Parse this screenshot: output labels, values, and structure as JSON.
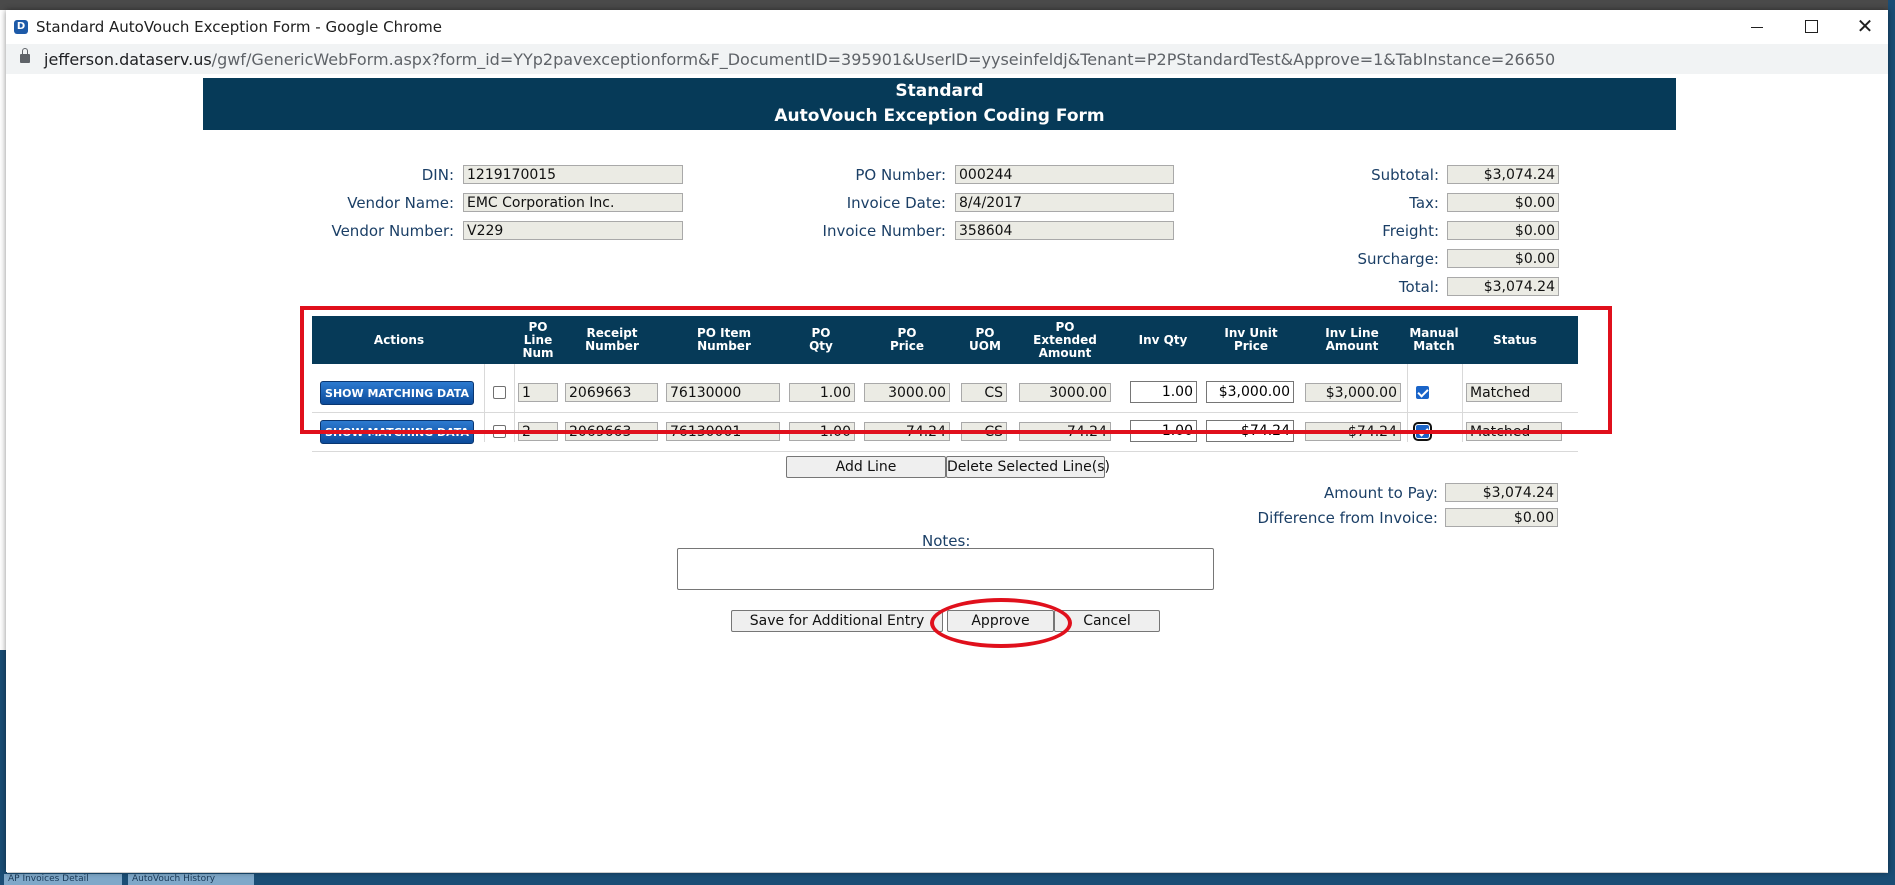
{
  "window": {
    "title": "Standard AutoVouch Exception Form - Google Chrome",
    "url_host": "jefferson.dataserv.us",
    "url_path": "/gwf/GenericWebForm.aspx?form_id=YYp2pavexceptionform&F_DocumentID=395901&UserID=yyseinfeldj&Tenant=P2PStandardTest&Approve=1&TabInstance=26650",
    "close_glyph": "✕"
  },
  "background_tabs": [
    "AP Invoices Detail",
    "AutoVouch History"
  ],
  "header": {
    "line1": "Standard",
    "line2": "AutoVouch Exception Coding Form"
  },
  "info": {
    "din_label": "DIN:",
    "din": "1219170015",
    "vendor_name_label": "Vendor Name:",
    "vendor_name": "EMC Corporation Inc.",
    "vendor_number_label": "Vendor Number:",
    "vendor_number": "V229",
    "po_number_label": "PO Number:",
    "po_number": "000244",
    "invoice_date_label": "Invoice Date:",
    "invoice_date": "8/4/2017",
    "invoice_number_label": "Invoice Number:",
    "invoice_number": "358604"
  },
  "totals": {
    "subtotal_label": "Subtotal:",
    "subtotal": "$3,074.24",
    "tax_label": "Tax:",
    "tax": "$0.00",
    "freight_label": "Freight:",
    "freight": "$0.00",
    "surcharge_label": "Surcharge:",
    "surcharge": "$0.00",
    "total_label": "Total:",
    "total": "$3,074.24"
  },
  "grid": {
    "headers": {
      "actions": "Actions",
      "po_line_num": "PO\nLine\nNum",
      "receipt_number": "Receipt\nNumber",
      "po_item_number": "PO Item\nNumber",
      "po_qty": "PO\nQty",
      "po_price": "PO\nPrice",
      "po_uom": "PO\nUOM",
      "po_extended_amount": "PO\nExtended\nAmount",
      "inv_qty": "Inv Qty",
      "inv_unit_price": "Inv Unit\nPrice",
      "inv_line_amount": "Inv Line\nAmount",
      "manual_match": "Manual\nMatch",
      "status": "Status"
    },
    "rows": [
      {
        "action": "SHOW MATCHING DATA",
        "selected": false,
        "po_line_num": "1",
        "receipt_number": "2069663",
        "po_item_number": "76130000",
        "po_qty": "1.00",
        "po_price": "3000.00",
        "po_uom": "CS",
        "po_extended_amount": "3000.00",
        "inv_qty": "1.00",
        "inv_unit_price": "$3,000.00",
        "inv_line_amount": "$3,000.00",
        "manual_match": true,
        "status": "Matched"
      },
      {
        "action": "SHOW MATCHING DATA",
        "selected": false,
        "po_line_num": "2",
        "receipt_number": "2069663",
        "po_item_number": "76130001",
        "po_qty": "1.00",
        "po_price": "74.24",
        "po_uom": "CS",
        "po_extended_amount": "74.24",
        "inv_qty": "1.00",
        "inv_unit_price": "$74.24",
        "inv_line_amount": "$74.24",
        "manual_match": true,
        "status": "Matched"
      }
    ]
  },
  "line_buttons": {
    "add": "Add Line",
    "delete": "Delete Selected Line(s)"
  },
  "payment": {
    "amount_to_pay_label": "Amount to Pay:",
    "amount_to_pay": "$3,074.24",
    "difference_label": "Difference from Invoice:",
    "difference": "$0.00"
  },
  "notes": {
    "label": "Notes:",
    "value": ""
  },
  "actions": {
    "save": "Save for Additional Entry",
    "approve": "Approve",
    "cancel": "Cancel"
  },
  "colors": {
    "header_band": "#063a58",
    "annotation_red": "#e0101c",
    "label_blue": "#1b3f66"
  }
}
